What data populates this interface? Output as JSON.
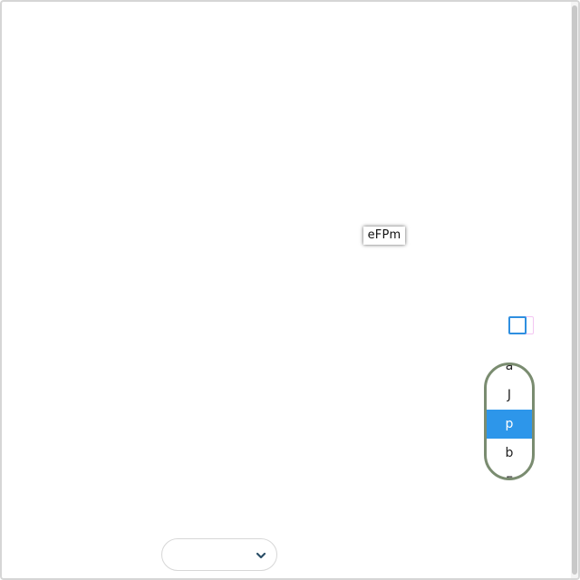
{
  "floating_label": {
    "text": "eFPm"
  },
  "checkbox": {
    "checked": false,
    "accent_color": "#2f8fe0",
    "ghost_color": "#f3c6f2"
  },
  "picker": {
    "items": [
      {
        "label": "a"
      },
      {
        "label": "J"
      },
      {
        "label": "p",
        "selected": true
      },
      {
        "label": "b"
      },
      {
        "label": "F"
      }
    ],
    "border_color": "#7a8c70",
    "selected_color": "#2d96ea"
  },
  "select": {
    "value": "",
    "icon": "chevron-down-icon",
    "chevron_color": "#2b4f67"
  }
}
